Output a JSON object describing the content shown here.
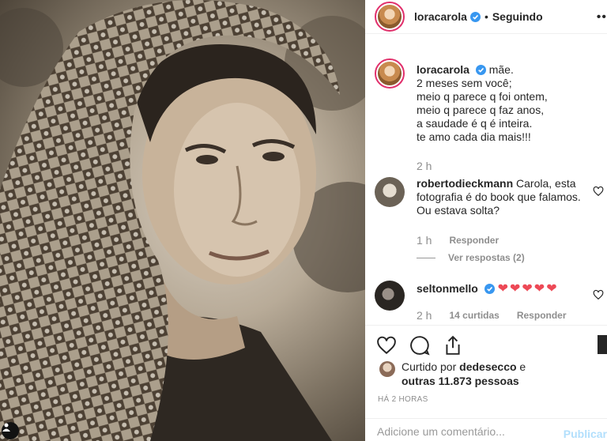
{
  "post": {
    "image_alt": "Vintage sepia photograph of a woman wearing a patterned headscarf"
  },
  "header": {
    "username": "loracarola",
    "separator": "•",
    "follow_status": "Seguindo"
  },
  "caption": {
    "username": "loracarola",
    "lines": [
      "mãe.",
      "2 meses sem você;",
      "meio q parece q foi ontem,",
      "meio q parece q faz anos,",
      "a saudade é q é inteira.",
      "te amo cada dia mais!!!"
    ],
    "time": "2 h"
  },
  "comments": [
    {
      "username": "robertodieckmann",
      "text": "Carola, esta fotografia é do book que falamos. Ou estava solta?",
      "time": "1 h",
      "reply_label": "Responder",
      "view_replies": "Ver respostas (2)"
    },
    {
      "username": "seltonmello",
      "text": "❤❤❤❤❤",
      "time": "2 h",
      "likes": "14 curtidas",
      "reply_label": "Responder"
    }
  ],
  "likes": {
    "prefix": "Curtido por",
    "user": "dedesecco",
    "connector": "e",
    "others": "outras 11.873 pessoas"
  },
  "timestamp": "HÁ 2 HORAS",
  "comment_box": {
    "placeholder": "Adicione um comentário...",
    "publish_label": "Publicar"
  },
  "colors": {
    "verified": "#3897f0",
    "heart_red": "#ed4956",
    "publish_disabled": "#b2dffc",
    "text": "#262626",
    "muted": "#8e8e8e"
  }
}
